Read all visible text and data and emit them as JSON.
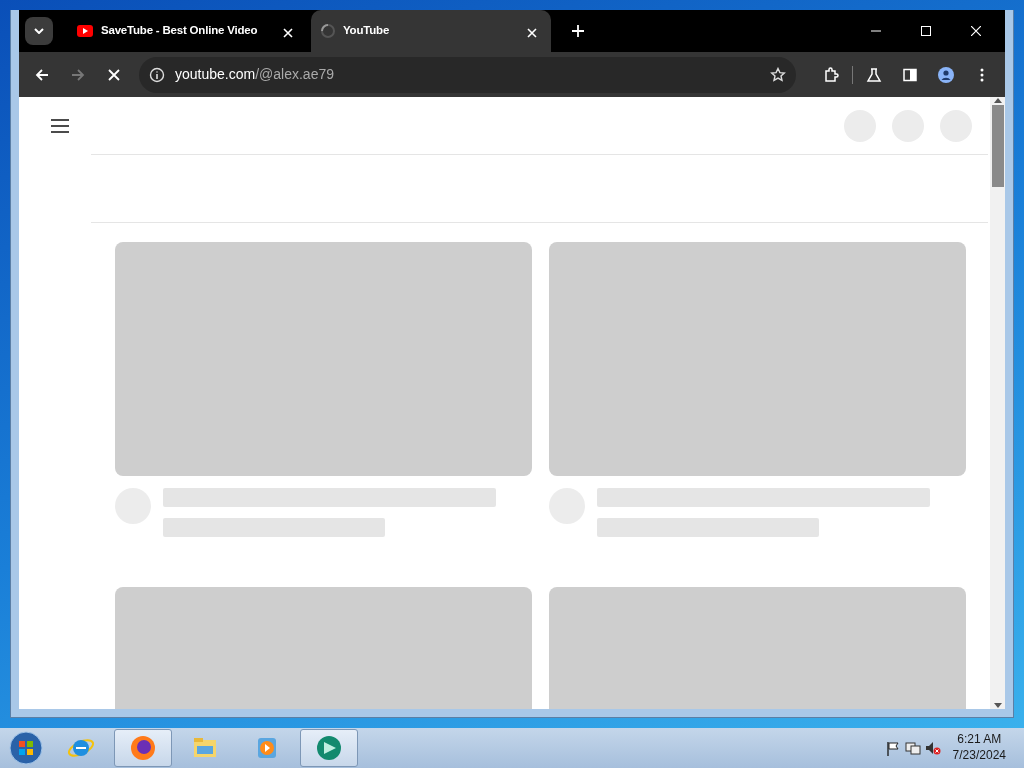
{
  "browser": {
    "tabs": [
      {
        "title": "SaveTube - Best Online Video",
        "selected": false,
        "loading": false
      },
      {
        "title": "YouTube",
        "selected": true,
        "loading": true
      }
    ],
    "address": {
      "host": "youtube.com",
      "path": "/@alex.ae79"
    },
    "loading": true
  },
  "page": {
    "header_buttons": [
      {
        "kind": "skeleton"
      },
      {
        "kind": "skeleton"
      },
      {
        "kind": "skeleton"
      }
    ],
    "video_grid": [
      {
        "kind": "skeleton"
      },
      {
        "kind": "skeleton"
      },
      {
        "kind": "thumbnail_skeleton"
      },
      {
        "kind": "thumbnail_skeleton"
      }
    ]
  },
  "taskbar": {
    "apps": [
      {
        "kind": "ie",
        "selected": false
      },
      {
        "kind": "firefox",
        "selected": true
      },
      {
        "kind": "explorer",
        "selected": false
      },
      {
        "kind": "media",
        "selected": false
      },
      {
        "kind": "app",
        "selected": true
      }
    ],
    "time": "6:21 AM",
    "date": "7/23/2024"
  }
}
